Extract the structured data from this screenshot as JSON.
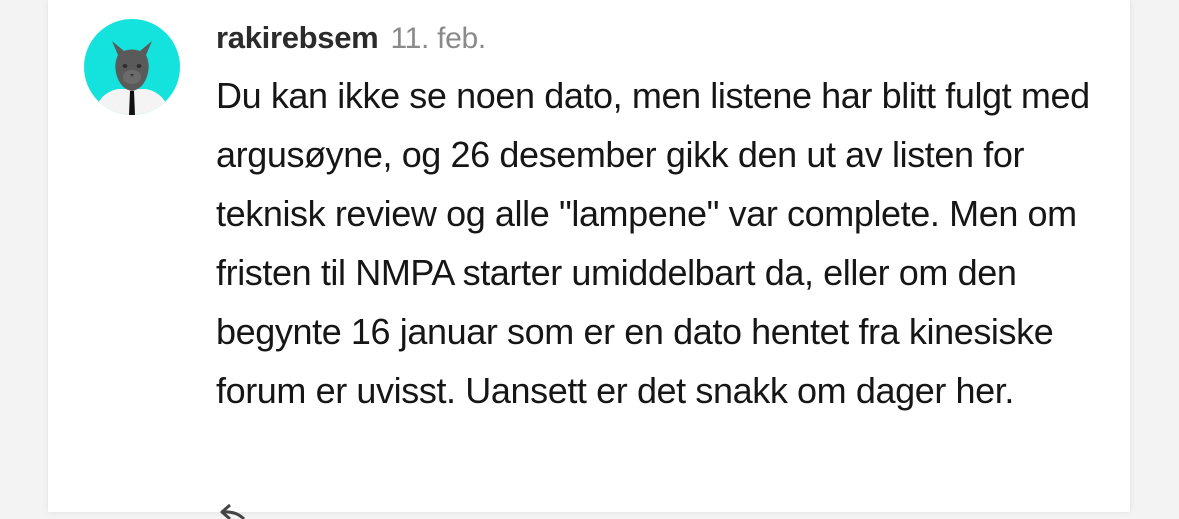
{
  "comment": {
    "username": "rakirebsem",
    "timestamp": "11. feb.",
    "body": "Du kan ikke se noen dato, men listene har blitt fulgt med argusøyne, og 26 desember gikk den ut av listen for teknisk review og alle \"lampene\" var complete. Men om fristen til NMPA starter umiddelbart da, eller om den begynte 16 januar som er en dato hentet fra kinesiske forum er uvisst. Uansett er det snakk om dager her."
  },
  "avatar": {
    "background": "#14e2dc",
    "description_icon": "cat-in-suit-avatar"
  },
  "icons": {
    "reply": "reply-arrow-icon"
  }
}
